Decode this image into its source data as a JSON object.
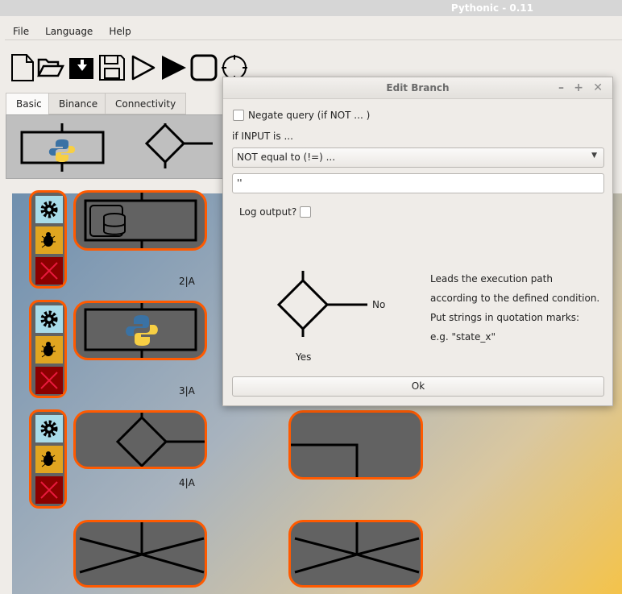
{
  "window": {
    "title": "Pythonic - 0.11"
  },
  "menu": [
    "File",
    "Language",
    "Help"
  ],
  "toolbar": [
    {
      "icon": "new-file-icon"
    },
    {
      "icon": "open-folder-icon"
    },
    {
      "icon": "save-as-icon"
    },
    {
      "icon": "save-icon"
    },
    {
      "icon": "run-outline-icon"
    },
    {
      "icon": "run-icon"
    },
    {
      "icon": "stop-icon"
    },
    {
      "icon": "debug-target-icon"
    }
  ],
  "tabs": [
    "Basic",
    "Binance",
    "Connectivity"
  ],
  "canvas": {
    "labels": [
      "2|A",
      "3|A",
      "4|A"
    ]
  },
  "dialog": {
    "title": "Edit Branch",
    "negate_label": "Negate query (if NOT ... )",
    "negate_checked": false,
    "condition_label": "if INPUT is ...",
    "condition_value": "NOT equal to (!=) ...",
    "compare_value": "''",
    "log_label": "Log output?",
    "log_checked": false,
    "no_label": "No",
    "yes_label": "Yes",
    "description": [
      "Leads the execution path",
      "according to the defined condition.",
      "Put strings in quotation marks:",
      "e.g. \"state_x\""
    ],
    "ok_label": "Ok"
  },
  "colors": {
    "accent": "#ff5a00",
    "block": "#626262",
    "settings": "#a8dbe8",
    "debug": "#e0a520",
    "delete": "#8b0000"
  }
}
